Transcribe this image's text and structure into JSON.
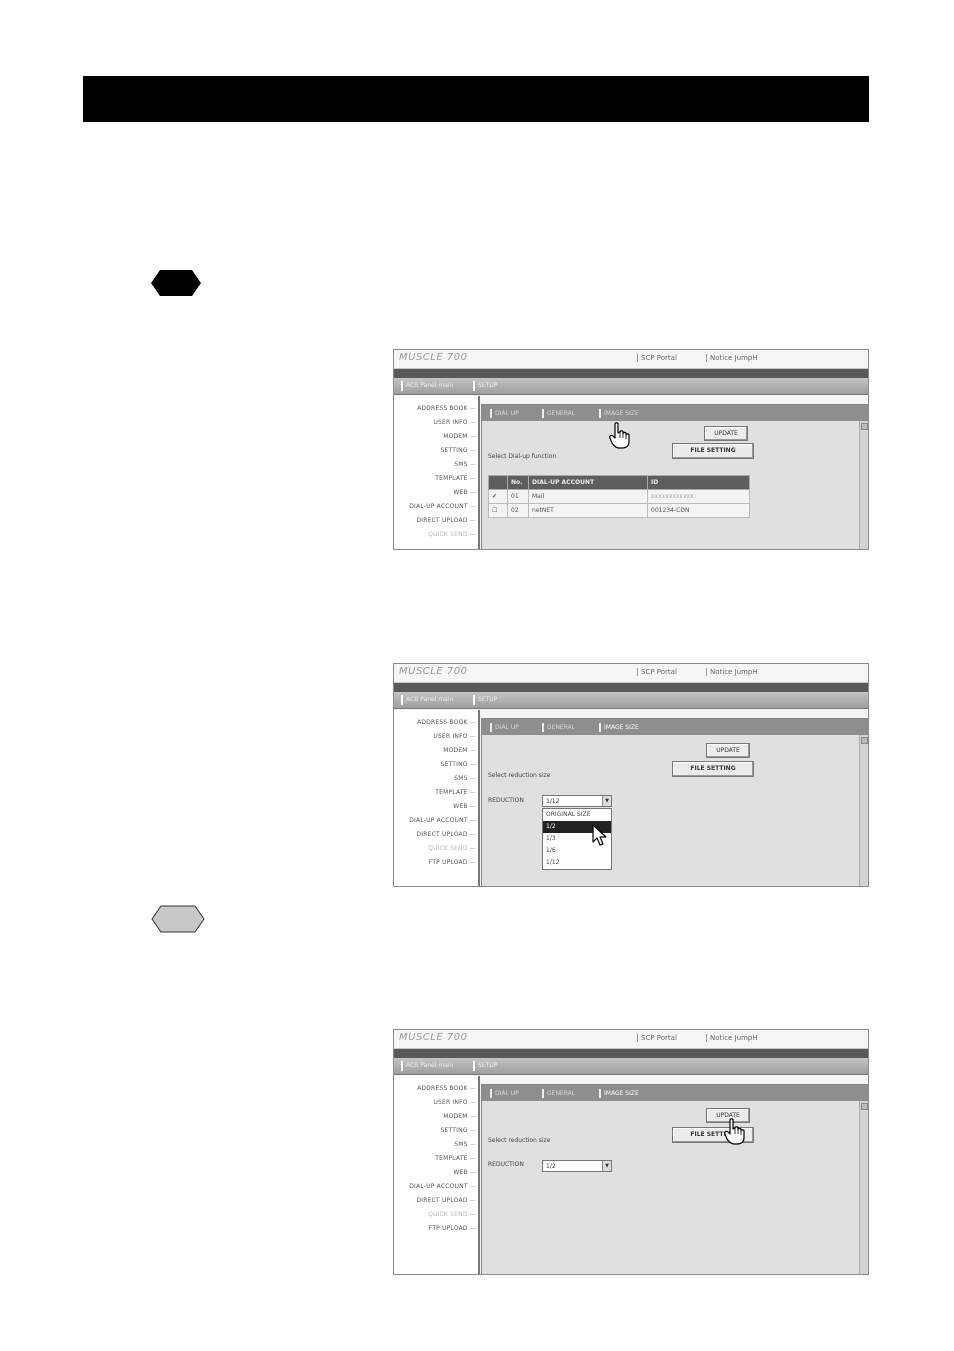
{
  "screens": [
    {
      "top_links": [
        "SCP Portal",
        "Notice JumpH"
      ],
      "nav_tabs": [
        "ACB Panel main",
        "SETUP"
      ],
      "sidebar_items": [
        {
          "label": "ADDRESS BOOK",
          "dim": false
        },
        {
          "label": "USER INFO",
          "dim": false
        },
        {
          "label": "MODEM",
          "dim": false
        },
        {
          "label": "SETTING",
          "dim": false
        },
        {
          "label": "SMS",
          "dim": false
        },
        {
          "label": "TEMPLATE",
          "dim": false
        },
        {
          "label": "WEB",
          "dim": false
        },
        {
          "label": "DIAL-UP ACCOUNT",
          "dim": false
        },
        {
          "label": "DIRECT UPLOAD",
          "dim": false
        },
        {
          "label": "QUICK SEND",
          "dim": true
        }
      ],
      "sub_tabs": [
        "DIAL UP",
        "GENERAL",
        "IMAGE SIZE"
      ],
      "update_label": "UPDATE",
      "file_setting_label": "FILE SETTING",
      "panel_text": "Select Dial-up function",
      "table": {
        "headers": [
          "",
          "No.",
          "DIAL-UP ACCOUNT",
          "ID"
        ],
        "rows": [
          [
            "✔",
            "01",
            "Mail",
            "xxxxxxxxxxxx"
          ],
          [
            "☐",
            "02",
            "netNET",
            "001234-CDN"
          ]
        ]
      }
    },
    {
      "top_links": [
        "SCP Portal",
        "Notice JumpH"
      ],
      "nav_tabs": [
        "ACB Panel main",
        "SETUP"
      ],
      "sidebar_items": [
        {
          "label": "ADDRESS BOOK",
          "dim": false
        },
        {
          "label": "USER INFO",
          "dim": false
        },
        {
          "label": "MODEM",
          "dim": false
        },
        {
          "label": "SETTING",
          "dim": false
        },
        {
          "label": "SMS",
          "dim": false
        },
        {
          "label": "TEMPLATE",
          "dim": false
        },
        {
          "label": "WEB",
          "dim": false
        },
        {
          "label": "DIAL-UP ACCOUNT",
          "dim": false
        },
        {
          "label": "DIRECT UPLOAD",
          "dim": false
        },
        {
          "label": "QUICK SEND",
          "dim": true
        },
        {
          "label": "FTP UPLOAD",
          "dim": false
        }
      ],
      "sub_tabs": [
        "DIAL UP",
        "GENERAL",
        "IMAGE SIZE"
      ],
      "update_label": "UPDATE",
      "file_setting_label": "FILE SETTING",
      "panel_text": "Select reduction size",
      "reduction_label": "REDUCTION",
      "select_value": "1/12",
      "options": [
        "ORIGINAL SIZE",
        "1/2",
        "1/3",
        "1/6",
        "1/12"
      ],
      "selected_option": 1
    },
    {
      "top_links": [
        "SCP Portal",
        "Notice JumpH"
      ],
      "nav_tabs": [
        "ACB Panel main",
        "SETUP"
      ],
      "sidebar_items": [
        {
          "label": "ADDRESS BOOK",
          "dim": false
        },
        {
          "label": "USER INFO",
          "dim": false
        },
        {
          "label": "MODEM",
          "dim": false
        },
        {
          "label": "SETTING",
          "dim": false
        },
        {
          "label": "SMS",
          "dim": false
        },
        {
          "label": "TEMPLATE",
          "dim": false
        },
        {
          "label": "WEB",
          "dim": false
        },
        {
          "label": "DIAL-UP ACCOUNT",
          "dim": false
        },
        {
          "label": "DIRECT UPLOAD",
          "dim": false
        },
        {
          "label": "QUICK SEND",
          "dim": true
        },
        {
          "label": "FTP UPLOAD",
          "dim": false
        }
      ],
      "sub_tabs": [
        "DIAL UP",
        "GENERAL",
        "IMAGE SIZE"
      ],
      "update_label": "UPDATE",
      "file_setting_label": "FILE SETTING",
      "panel_text": "Select reduction size",
      "reduction_label": "REDUCTION",
      "select_value": "1/2"
    }
  ],
  "colors": {
    "header_bar": "#000000",
    "badge_dark": "#000000",
    "badge_light": "#c8c8c8",
    "table_header": "#5e5e5e"
  }
}
